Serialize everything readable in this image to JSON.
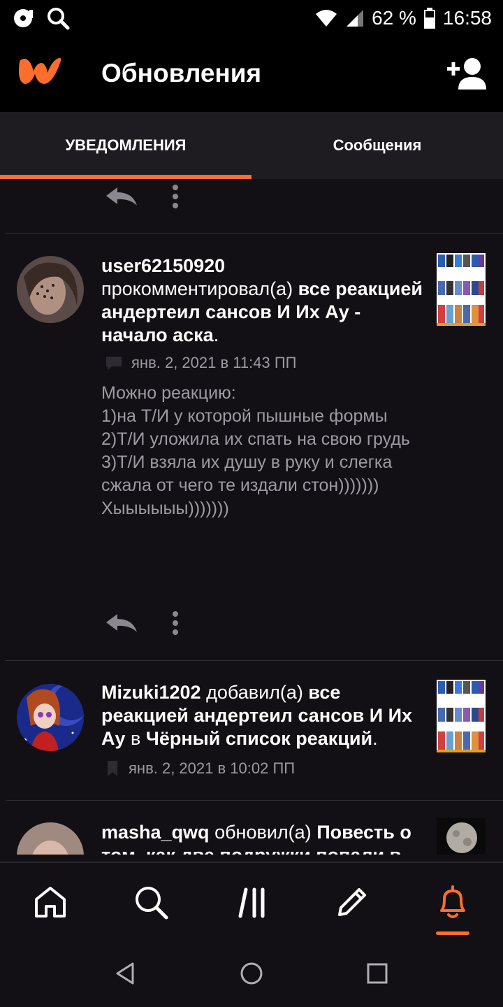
{
  "status_bar": {
    "battery": "62 %",
    "time": "16:58",
    "icons": [
      "cd-icon",
      "search-icon",
      "wifi-icon",
      "signal-icon",
      "battery-icon"
    ]
  },
  "header": {
    "title": "Обновления",
    "logo_icon": "wattpad-logo",
    "action_icon": "add-user-icon"
  },
  "tabs": [
    {
      "label": "УВЕДОМЛЕНИЯ",
      "active": true
    },
    {
      "label": "Сообщения",
      "active": false
    }
  ],
  "notifications": [
    {
      "user": "user62150920",
      "verb": "прокомментировал(а)",
      "story": "все реакцией андертеил сансов И Их Ау - начало аска",
      "suffix": ".",
      "timestamp": "янв. 2, 2021 в 11:43 ПП",
      "comment": "Можно реакцию:\n1)на Т/И у которой пышные формы\n2)Т/И уложила их спать на свою грудь\n3)Т/И взяла их душу в руку и слегка сжала от чего те издали стон)))))))\nХыыыыыы)))))))"
    },
    {
      "user": "Mizuki1202",
      "verb": "добавил(а)",
      "story": "все реакцией андертеил сансов И Их Ау",
      "connector": "в",
      "list": "Чёрный список реакций",
      "suffix": ".",
      "timestamp": "янв. 2, 2021 в 10:02 ПП"
    },
    {
      "user": "masha_qwq",
      "verb": "обновил(а)",
      "story": "Повесть о том, как две подружки попали в"
    }
  ],
  "bottom_nav": [
    {
      "name": "home-icon",
      "active": false
    },
    {
      "name": "search-icon",
      "active": false
    },
    {
      "name": "library-icon",
      "active": false
    },
    {
      "name": "write-icon",
      "active": false
    },
    {
      "name": "bell-icon",
      "active": true
    }
  ],
  "colors": {
    "accent": "#ff6d2c",
    "background": "#121014",
    "muted_text": "#9d9aa2"
  }
}
